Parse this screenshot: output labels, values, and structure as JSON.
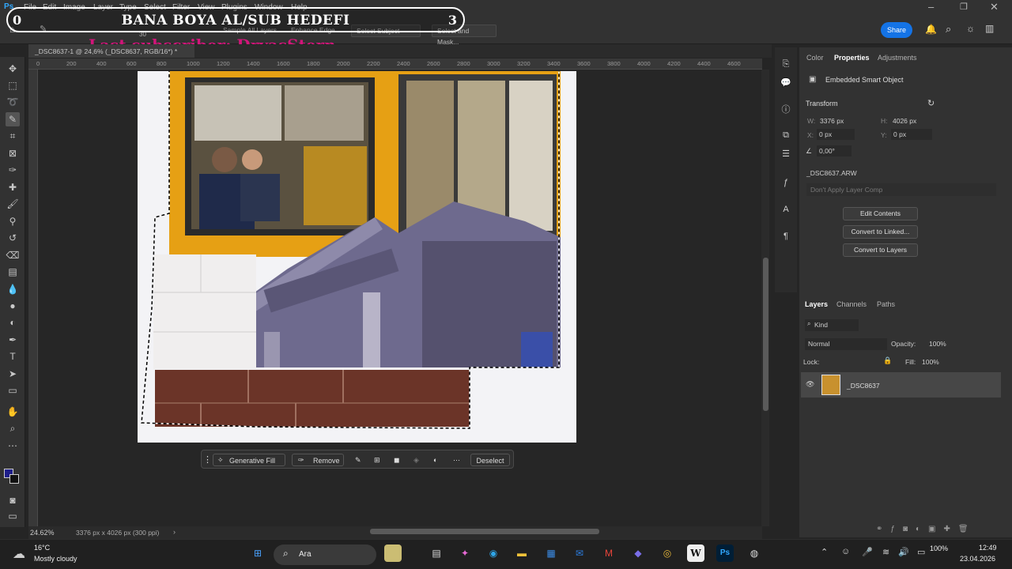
{
  "menu": [
    "File",
    "Edit",
    "Image",
    "Layer",
    "Type",
    "Select",
    "Filter",
    "View",
    "Plugins",
    "Window",
    "Help"
  ],
  "overlay": {
    "title": "BANA BOYA AL/SUB HEDEFI",
    "left_number": "0",
    "right_number": "3",
    "subtitle": "Last subscriber: DryasStern"
  },
  "options_bar": {
    "sample_all_layers": "Sample All Layers",
    "enhance_edge": "Enhance Edge",
    "select_subject": "Select Subject",
    "select_and_mask": "Select and Mask...",
    "brush_size": "30"
  },
  "header_right": {
    "share": "Share"
  },
  "document_tab": "_DSC8637-1 @ 24,6% (_DSC8637, RGB/16*) *",
  "ruler": {
    "ticks": [
      "0",
      "200",
      "400",
      "600",
      "800",
      "1000",
      "1200",
      "1400",
      "1600",
      "1800",
      "2000",
      "2200",
      "2400",
      "2600",
      "2800",
      "3000",
      "3200",
      "3400",
      "3600",
      "3800",
      "4000",
      "4200",
      "4400",
      "4600"
    ]
  },
  "contextual_taskbar": {
    "generative_fill": "Generative Fill",
    "remove": "Remove",
    "deselect": "Deselect"
  },
  "status": {
    "zoom": "24.62%",
    "doc_info": "3376 px x 4026 px (300 ppi)"
  },
  "properties": {
    "tabs": [
      "Color",
      "Properties",
      "Adjustments"
    ],
    "object_type": "Embedded Smart Object",
    "transform_title": "Transform",
    "w_label": "W:",
    "w": "3376 px",
    "h_label": "H:",
    "h": "4026 px",
    "x_label": "X:",
    "x": "0 px",
    "y_label": "Y:",
    "y": "0 px",
    "angle": "0,00°",
    "file": "_DSC8637.ARW",
    "layer_comp": "Don't Apply Layer Comp",
    "btn_edit": "Edit Contents",
    "btn_linked": "Convert to Linked...",
    "btn_layers": "Convert to Layers"
  },
  "layers_panel": {
    "tabs": [
      "Layers",
      "Channels",
      "Paths"
    ],
    "kind": "Kind",
    "blend": "Normal",
    "opacity_label": "Opacity:",
    "opacity": "100%",
    "lock_label": "Lock:",
    "fill_label": "Fill:",
    "fill": "100%",
    "layer_name": "_DSC8637"
  },
  "weather": {
    "temp": "16°C",
    "desc": "Mostly cloudy"
  },
  "taskbar": {
    "search": "Ara",
    "battery": "100%",
    "time": "12:49",
    "date": "23.04.2026"
  },
  "colors": {
    "accent": "#1473e6",
    "panel": "#323232",
    "canvas": "#262626",
    "overlay_sub": "#d2157a"
  }
}
